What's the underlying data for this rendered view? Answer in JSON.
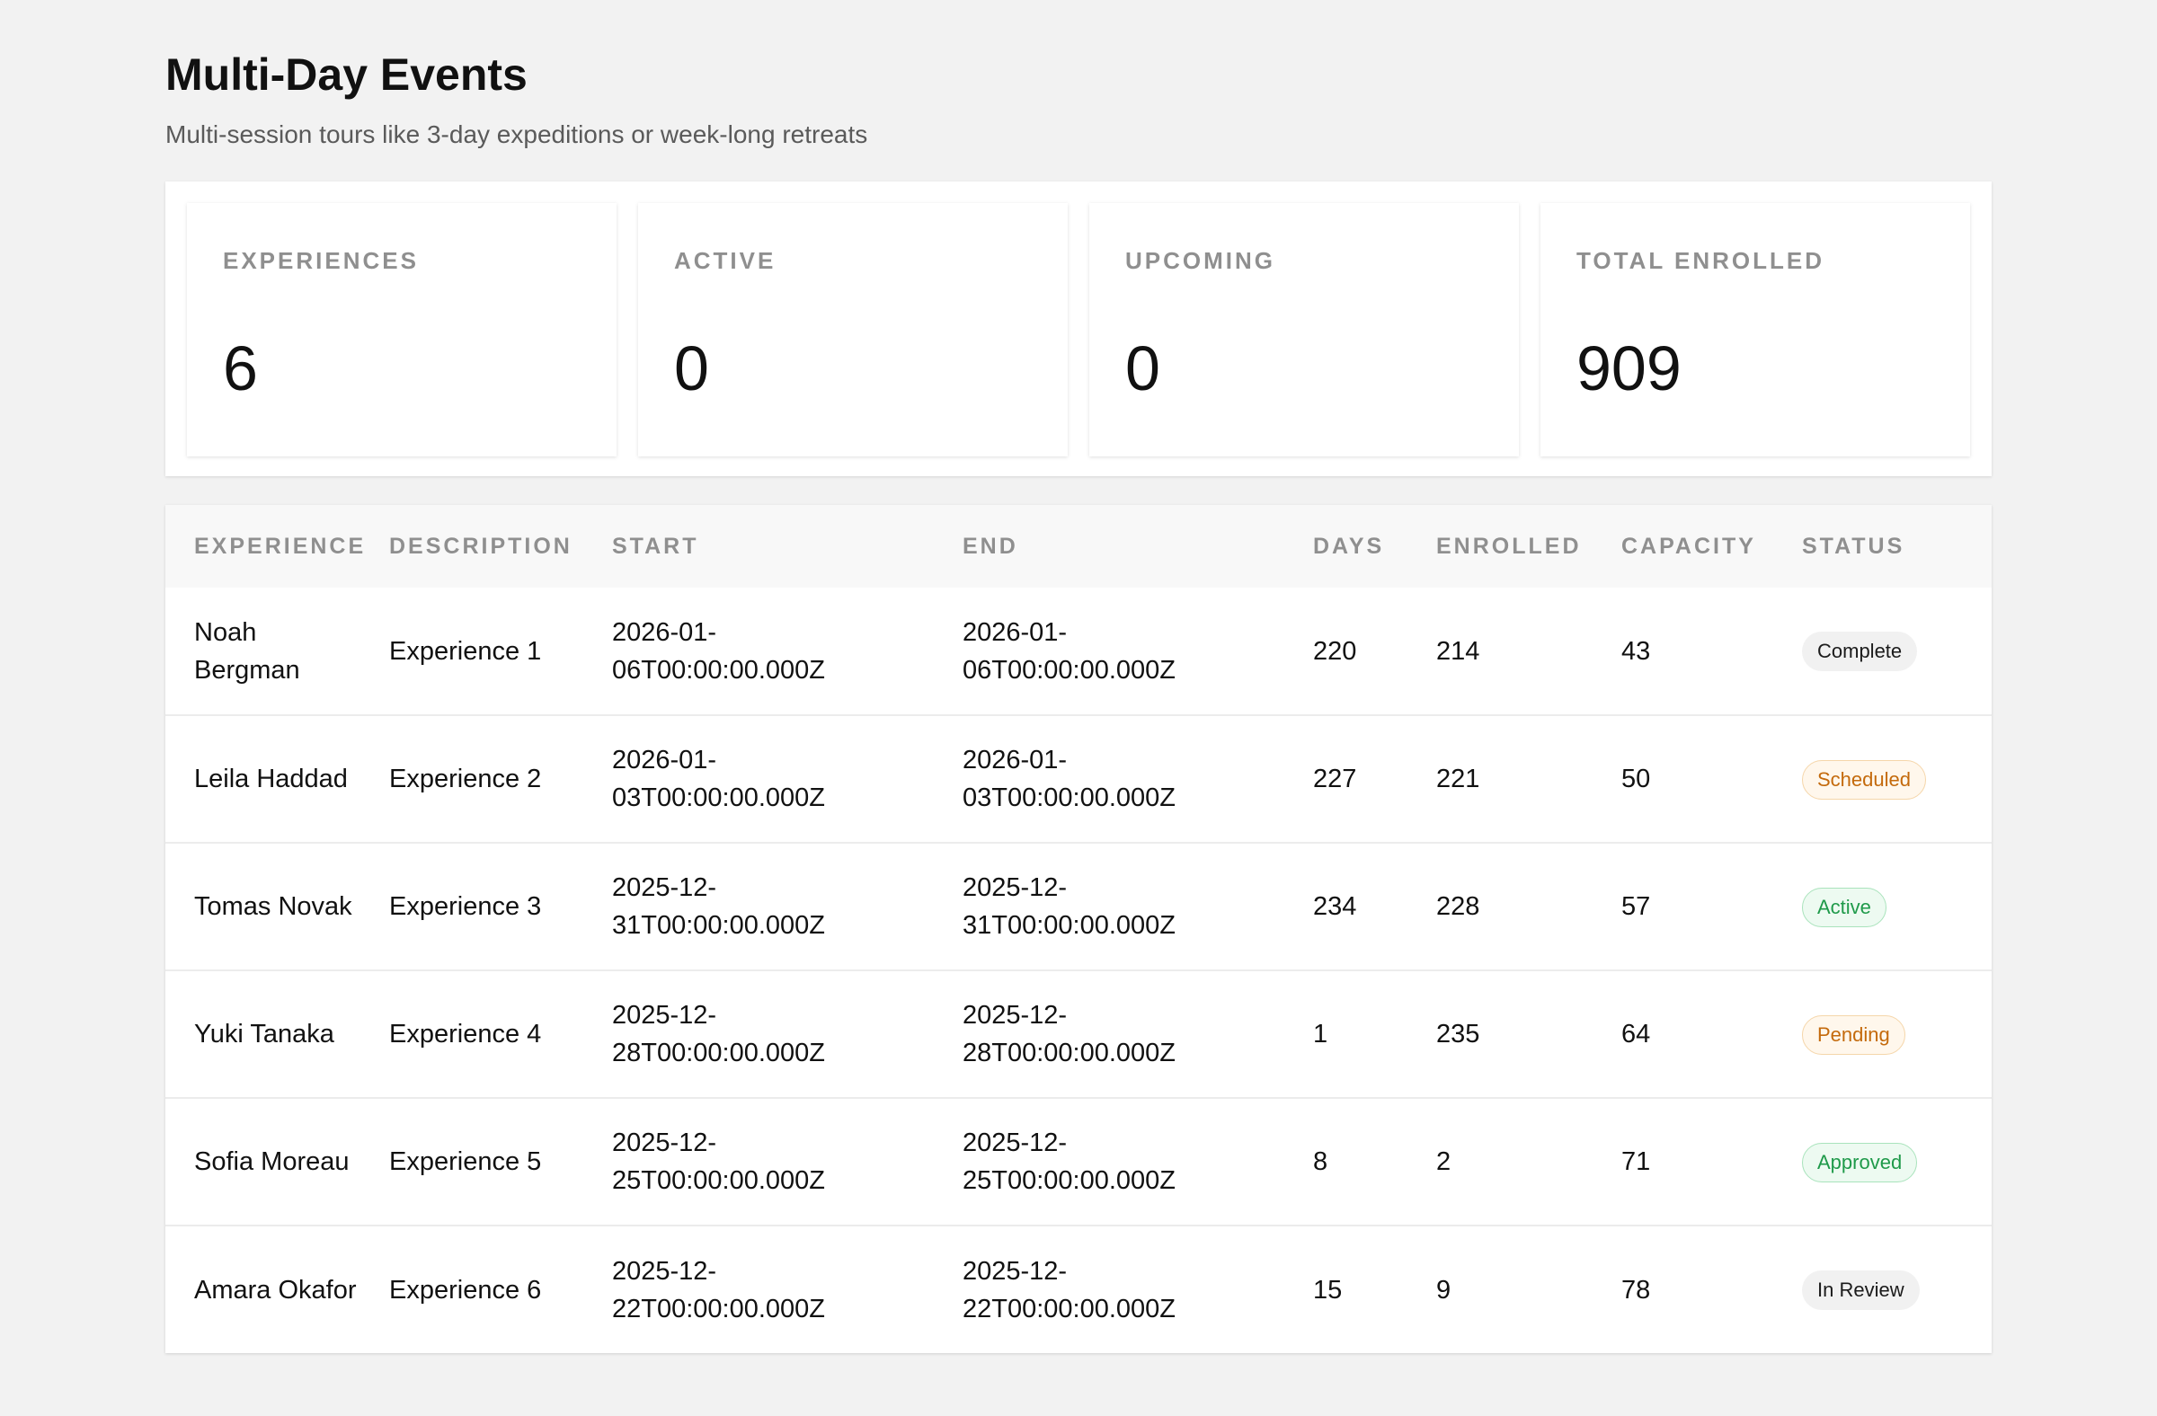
{
  "header": {
    "title": "Multi-Day Events",
    "subtitle": "Multi-session tours like 3-day expeditions or week-long retreats"
  },
  "stats": [
    {
      "label": "EXPERIENCES",
      "value": "6"
    },
    {
      "label": "ACTIVE",
      "value": "0"
    },
    {
      "label": "UPCOMING",
      "value": "0"
    },
    {
      "label": "TOTAL ENROLLED",
      "value": "909"
    }
  ],
  "table": {
    "columns": [
      "EXPERIENCE",
      "DESCRIPTION",
      "START",
      "END",
      "DAYS",
      "ENROLLED",
      "CAPACITY",
      "STATUS"
    ],
    "rows": [
      {
        "experience": "Noah Bergman",
        "description": "Experience 1",
        "start": "2026-01-06T00:00:00.000Z",
        "end": "2026-01-06T00:00:00.000Z",
        "days": "220",
        "enrolled": "214",
        "capacity": "43",
        "status": "Complete"
      },
      {
        "experience": "Leila Haddad",
        "description": "Experience 2",
        "start": "2026-01-03T00:00:00.000Z",
        "end": "2026-01-03T00:00:00.000Z",
        "days": "227",
        "enrolled": "221",
        "capacity": "50",
        "status": "Scheduled"
      },
      {
        "experience": "Tomas Novak",
        "description": "Experience 3",
        "start": "2025-12-31T00:00:00.000Z",
        "end": "2025-12-31T00:00:00.000Z",
        "days": "234",
        "enrolled": "228",
        "capacity": "57",
        "status": "Active"
      },
      {
        "experience": "Yuki Tanaka",
        "description": "Experience 4",
        "start": "2025-12-28T00:00:00.000Z",
        "end": "2025-12-28T00:00:00.000Z",
        "days": "1",
        "enrolled": "235",
        "capacity": "64",
        "status": "Pending"
      },
      {
        "experience": "Sofia Moreau",
        "description": "Experience 5",
        "start": "2025-12-25T00:00:00.000Z",
        "end": "2025-12-25T00:00:00.000Z",
        "days": "8",
        "enrolled": "2",
        "capacity": "71",
        "status": "Approved"
      },
      {
        "experience": "Amara Okafor",
        "description": "Experience 6",
        "start": "2025-12-22T00:00:00.000Z",
        "end": "2025-12-22T00:00:00.000Z",
        "days": "15",
        "enrolled": "9",
        "capacity": "78",
        "status": "In Review"
      }
    ]
  },
  "status_colors": {
    "Complete": "#1b1b1b",
    "In Review": "#1b1b1b",
    "Scheduled": "#c46a0c",
    "Pending": "#c46a0c",
    "Active": "#1f9a4a",
    "Approved": "#1f9a4a"
  }
}
